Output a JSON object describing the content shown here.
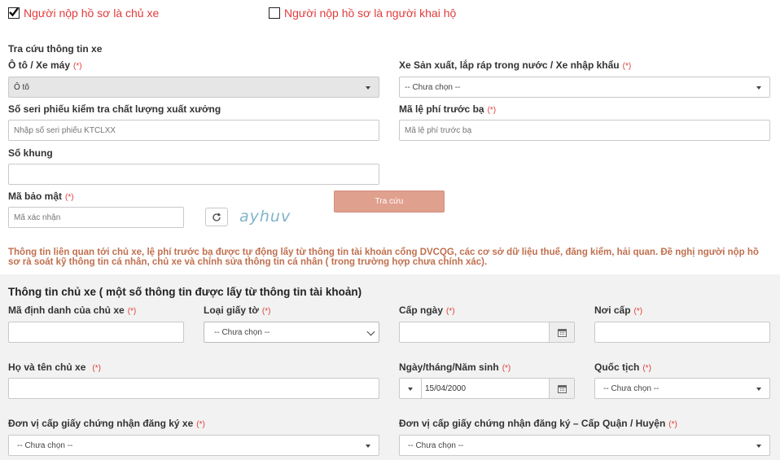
{
  "applicant": {
    "owner_label": "Người nộp hồ sơ là chủ xe",
    "owner_checked": true,
    "proxy_label": "Người nộp hồ sơ là người khai hộ",
    "proxy_checked": false
  },
  "lookup": {
    "section_title": "Tra cứu thông tin xe",
    "vehicle_type_label": "Ô tô / Xe máy",
    "vehicle_type_value": "Ô tô",
    "origin_label": "Xe Sản xuất, lắp ráp trong nước / Xe nhập khẩu",
    "origin_value": "-- Chưa chọn --",
    "serial_label": "Số seri phiếu kiểm tra chất lượng xuất xưởng",
    "serial_placeholder": "Nhập số seri phiếu KTCLXX",
    "fee_code_label": "Mã lệ phí trước bạ",
    "fee_code_placeholder": "Mã lệ phí trước bạ",
    "frame_label": "Số khung",
    "captcha_label": "Mã bảo mật",
    "captcha_placeholder": "Mã xác nhận",
    "captcha_text": "ayhuv",
    "search_button": "Tra cứu",
    "required_mark": "(*)"
  },
  "notice": "Thông tin liên quan tới chủ xe, lệ phí trước bạ được tự động lấy từ thông tin tài khoản cổng DVCQG, các cơ sở dữ liệu thuế, đăng kiểm, hải quan. Đề nghị người nộp hồ sơ rà soát kỹ thông tin cá nhân, chủ xe và chỉnh sửa thông tin cá nhân ( trong trường hợp chưa chính xác).",
  "owner": {
    "section_title": "Thông tin chủ xe ( một số thông tin được lấy từ thông tin tài khoản)",
    "id_label": "Mã định danh của chủ xe",
    "doc_type_label": "Loại giấy tờ",
    "doc_type_value": "-- Chưa chọn --",
    "issue_date_label": "Cấp ngày",
    "issue_place_label": "Nơi cấp",
    "name_label": "Họ và tên chủ xe",
    "dob_label": "Ngày/tháng/Năm sinh",
    "dob_value": "15/04/2000",
    "nationality_label": "Quốc tịch",
    "nationality_value": "-- Chưa chọn --",
    "reg_unit_label": "Đơn vị cấp giấy chứng nhận đăng ký xe",
    "reg_unit_value": "-- Chưa chọn --",
    "reg_district_label": "Đơn vị cấp giấy chứng nhận đăng ký – Cấp Quận / Huyện",
    "reg_district_value": "-- Chưa chọn --"
  },
  "colors": {
    "red": "#e23b3b",
    "notice": "#c0704f",
    "button": "#e0a08e"
  }
}
